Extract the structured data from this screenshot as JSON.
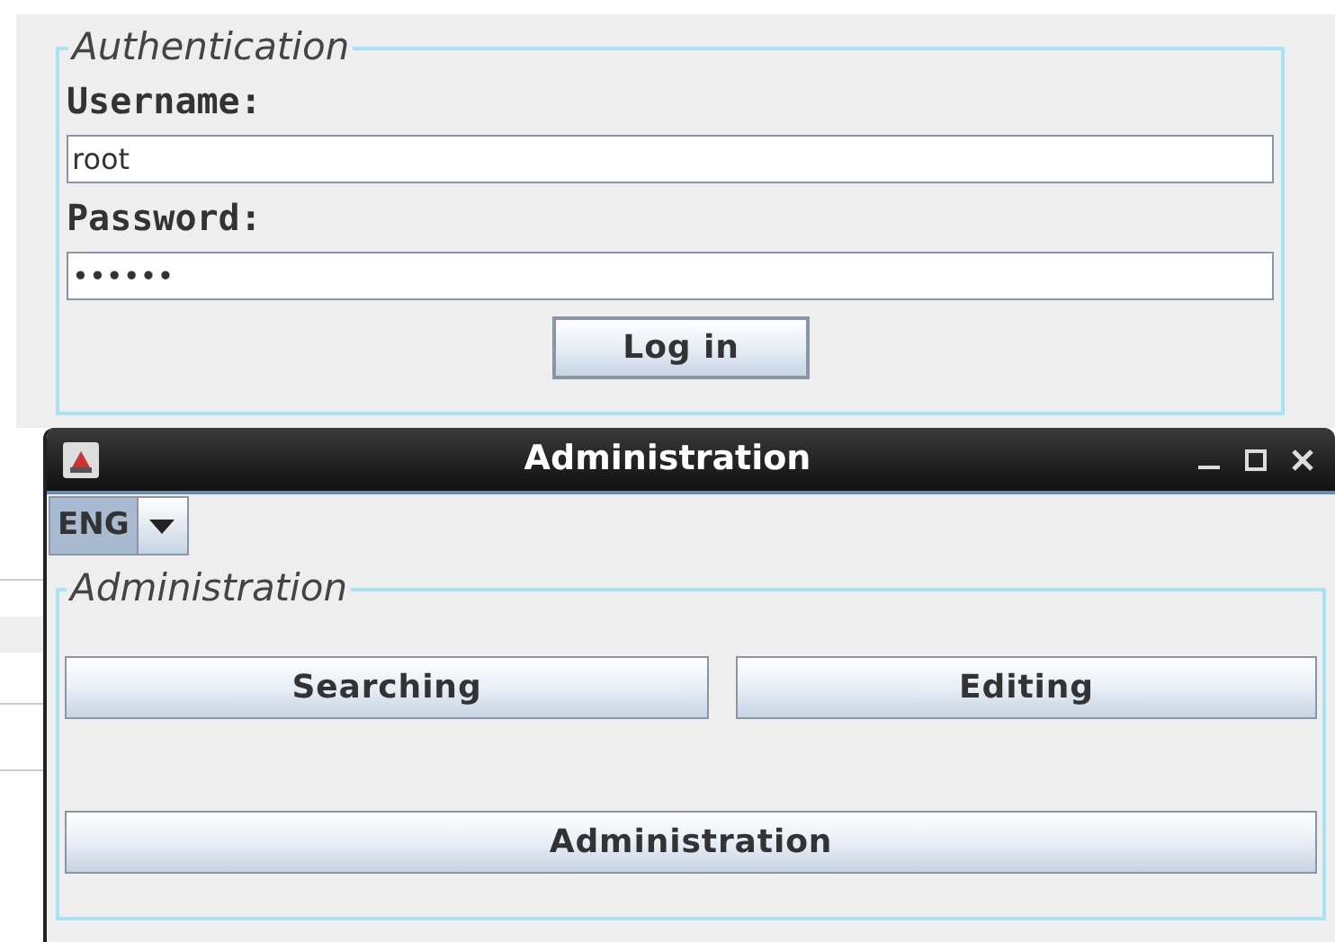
{
  "login_panel": {
    "legend": "Authentication",
    "fields": [
      {
        "label": "Username:",
        "value": "root"
      },
      {
        "label": "Password:",
        "value": "••••••"
      }
    ],
    "button": "Log in"
  },
  "window": {
    "title": "Administration",
    "language": "ENG",
    "panel": {
      "legend": "Administration",
      "buttons": [
        "Searching",
        "Editing",
        "Administration"
      ]
    }
  }
}
